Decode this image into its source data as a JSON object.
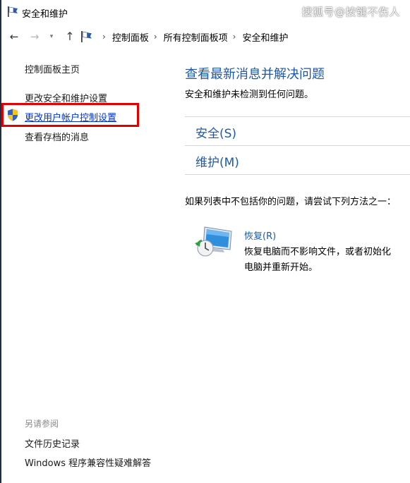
{
  "window": {
    "title": "安全和维护",
    "watermark": "搜狐号@按键不伤人"
  },
  "navbar": {
    "back_icon": "arrow-left-icon",
    "forward_icon": "arrow-right-icon",
    "recent_icon": "chevron-down-icon",
    "up_icon": "arrow-up-icon",
    "breadcrumbs": [
      "控制面板",
      "所有控制面板项",
      "安全和维护"
    ]
  },
  "sidebar": {
    "home": "控制面板主页",
    "items": [
      "更改安全和维护设置",
      "更改用户帐户控制设置",
      "查看存档的消息"
    ],
    "see_also_label": "另请参阅",
    "see_also": [
      "文件历史记录",
      "Windows 程序兼容性疑难解答"
    ]
  },
  "main": {
    "title": "查看最新消息并解决问题",
    "subtitle": "安全和维护未检测到任何问题。",
    "sections": [
      "安全(S)",
      "维护(M)"
    ],
    "try_text": "如果列表中不包括你的问题，请尝试下列方法之一：",
    "recovery": {
      "link": "恢复(R)",
      "description": "恢复电脑而不影响文件，或者初始化电脑并重新开始。"
    }
  },
  "colors": {
    "link_blue": "#1c5aa8",
    "uac_link": "#0033cc",
    "highlight_red": "#e00000"
  }
}
